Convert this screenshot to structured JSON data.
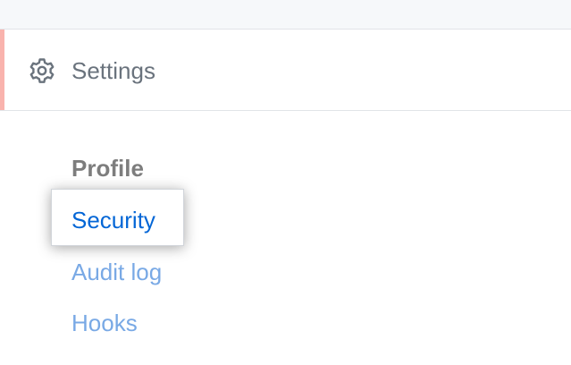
{
  "settings": {
    "title": "Settings",
    "icon": "gear-icon",
    "accent_color": "#f9b3ad"
  },
  "nav": {
    "heading": "Profile",
    "items": [
      {
        "label": "Security",
        "selected": true
      },
      {
        "label": "Audit log",
        "selected": false
      },
      {
        "label": "Hooks",
        "selected": false
      }
    ]
  },
  "colors": {
    "link": "#79a9e5",
    "link_active": "#0366d6",
    "muted_text": "#6a737d"
  }
}
